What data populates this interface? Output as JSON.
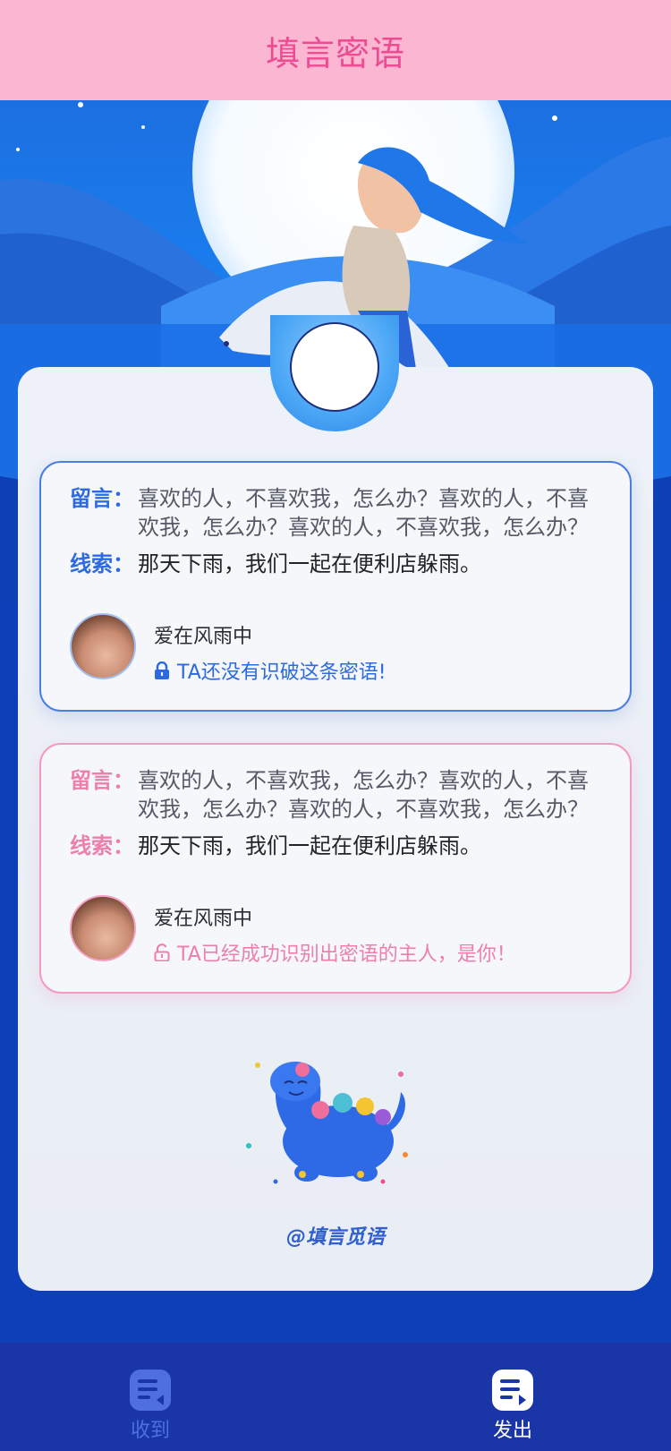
{
  "header": {
    "title": "填言密语"
  },
  "cards": [
    {
      "theme": "blue",
      "message_label": "留言：",
      "message_text": "喜欢的人，不喜欢我，怎么办？喜欢的人，不喜欢我，怎么办？喜欢的人，不喜欢我，怎么办？",
      "clue_label": "线索：",
      "clue_text": "那天下雨，我们一起在便利店躲雨。",
      "user_name": "爱在风雨中",
      "status_text": "TA还没有识破这条密语!",
      "status_icon": "lock-icon"
    },
    {
      "theme": "pink",
      "message_label": "留言：",
      "message_text": "喜欢的人，不喜欢我，怎么办？喜欢的人，不喜欢我，怎么办？喜欢的人，不喜欢我，怎么办？",
      "clue_label": "线索：",
      "clue_text": "那天下雨，我们一起在便利店躲雨。",
      "user_name": "爱在风雨中",
      "status_text": "TA已经成功识别出密语的主人，是你！",
      "status_icon": "unlock-icon"
    }
  ],
  "brand": "@填言觅语",
  "tabs": [
    {
      "label": "收到",
      "icon": "inbox-icon",
      "active": false
    },
    {
      "label": "发出",
      "icon": "outbox-icon",
      "active": true
    }
  ],
  "colors": {
    "header_bg": "#fbb6d2",
    "title": "#ee4c92",
    "blue": "#2d6ae0",
    "pink": "#ee7fab",
    "tabbar": "#1a35a6"
  }
}
